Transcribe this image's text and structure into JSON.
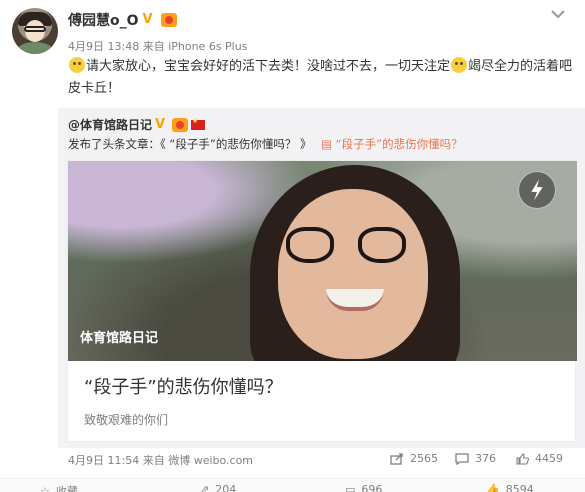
{
  "post": {
    "author": "傅园慧o_O",
    "timestamp": "4月9日 13:48",
    "source": "来自 iPhone 6s Plus",
    "text_part1": "请大家放心，宝宝会好好的活下去类！没啥过不去，一切天注定",
    "text_part2": "竭尽全力的活着吧皮卡丘！"
  },
  "repost": {
    "author": "@体育馆路日记",
    "published_prefix": "发布了头条文章：《 “段子手”的悲伤你懂吗？ 》",
    "article_link": "“段子手”的悲伤你懂吗？",
    "article": {
      "image_caption": "体育馆路日记",
      "title": "“段子手”的悲伤你懂吗？",
      "subtitle": "致敬艰难的你们"
    },
    "timestamp": "4月9日 11:54",
    "source": "来自 微博 weibo.com",
    "share_count": "2565",
    "comment_count": "376",
    "like_count": "4459"
  },
  "actions": {
    "collect": "收藏",
    "repost": "204",
    "comment": "696",
    "like": "8594"
  },
  "colors": {
    "link": "#eb7350",
    "verified": "#f7a400",
    "muted": "#808080"
  }
}
